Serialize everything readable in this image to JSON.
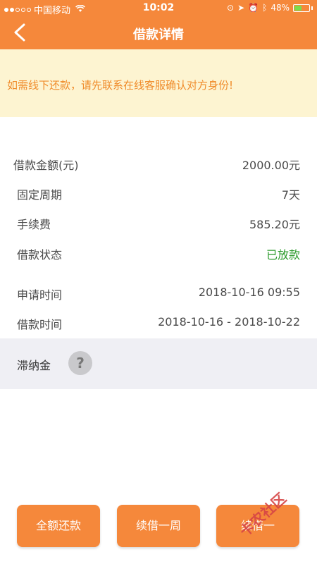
{
  "status_bar": {
    "carrier": "中国移动",
    "time": "10:02",
    "battery": "48%",
    "battery_level": 0.48
  },
  "nav": {
    "title": "借款详情",
    "back_icon": "chevron-left-icon"
  },
  "notice": {
    "text": "如需线下还款，请先联系在线客服确认对方身份!"
  },
  "details": {
    "amount": {
      "label": "借款金额(元)",
      "value": "2000.00元"
    },
    "period": {
      "label": "固定周期",
      "value": "7天"
    },
    "fee": {
      "label": "手续费",
      "value": "585.20元"
    },
    "status": {
      "label": "借款状态",
      "value": "已放款"
    },
    "apply_time": {
      "label": "申请时间",
      "value": "2018-10-16 09:55"
    },
    "loan_time": {
      "label": "借款时间",
      "value": "2018-10-16 - 2018-10-22"
    }
  },
  "late_fee": {
    "label": "滞纳金",
    "help_icon": "question-icon",
    "help_text": "?"
  },
  "buttons": {
    "repay_all": "全额还款",
    "renew_week": "续借一周",
    "renew_other": "续借一"
  },
  "watermark": "卡农社区",
  "colors": {
    "accent": "#f5883b",
    "notice_bg": "#fdf4d1",
    "notice_text": "#f08b2a",
    "status_green": "#2b9a2b"
  }
}
